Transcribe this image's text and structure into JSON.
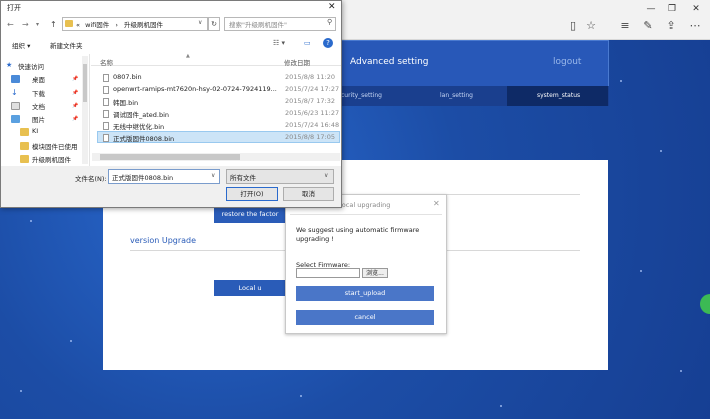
{
  "router": {
    "title": "Advanced setting",
    "logout": "logout",
    "tabs": [
      "curity_setting",
      "lan_setting",
      "system_status"
    ],
    "restore_btn": "restore the factor",
    "version_upgrade": "version Upgrade",
    "local_btn": "Local u"
  },
  "modal": {
    "title": "local upgrading",
    "message": "We suggest using automatic firmware upgrading !",
    "firmware_label": "Select Firmware:",
    "browse": "浏览...",
    "start": "start_upload",
    "cancel": "cancel"
  },
  "dialog": {
    "title": "打开",
    "path_prefix": "«",
    "path_1": "wifi固件",
    "path_sep": "›",
    "path_2": "升级刷机固件",
    "search_placeholder": "搜索\"升级刷机固件\"",
    "organize": "组织 ▾",
    "new_folder": "新建文件夹",
    "nav": [
      {
        "label": "快速访问",
        "pinned": false
      },
      {
        "label": "桌面",
        "pinned": true
      },
      {
        "label": "下载",
        "pinned": true
      },
      {
        "label": "文档",
        "pinned": true
      },
      {
        "label": "图片",
        "pinned": true
      },
      {
        "label": "KI",
        "pinned": false
      },
      {
        "label": "模块固件已使用",
        "pinned": false
      },
      {
        "label": "升级刷机固件",
        "pinned": false
      }
    ],
    "col_name": "名称",
    "col_date": "修改日期",
    "files": [
      {
        "name": "0807.bin",
        "date": "2015/8/8 11:20"
      },
      {
        "name": "openwrt-ramips-mt7620n-hsy-02-0724-7924119...",
        "date": "2015/7/24 17:27"
      },
      {
        "name": "韩国.bin",
        "date": "2015/8/7 17:32"
      },
      {
        "name": "调试固件_ated.bin",
        "date": "2015/6/23 11:27"
      },
      {
        "name": "无线中继优化.bin",
        "date": "2015/7/24 16:48"
      },
      {
        "name": "正式版固件0808.bin",
        "date": "2015/8/8 17:05"
      }
    ],
    "filename_label": "文件名(N):",
    "filename_value": "正式版固件0808.bin",
    "filetype": "所有文件",
    "open": "打开(O)",
    "cancel": "取消"
  },
  "colors": {
    "accent": "#2a5cb8",
    "header": "#2858b8",
    "background": "#1c4da6",
    "selection": "#cce4f7"
  }
}
